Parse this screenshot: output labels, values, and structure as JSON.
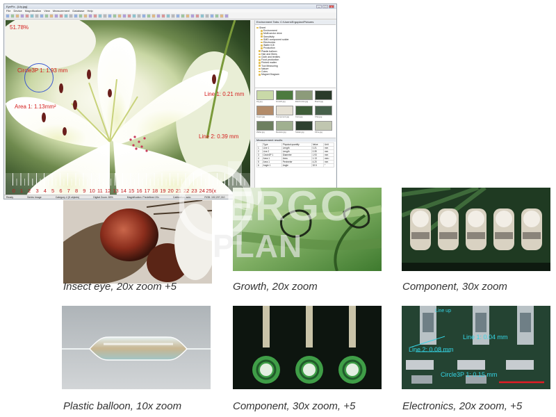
{
  "app": {
    "title": "EyePix - [Lily.jpg]",
    "menu": [
      "File",
      "Device",
      "Magnification",
      "View",
      "Measurement",
      "Database",
      "Help"
    ],
    "measurements": {
      "top_left": "51.78%",
      "circle": "Circle3P 1: 1.93 mm",
      "line1": "Line 1: 0.21 mm",
      "area": "Area 1: 1.13mm²",
      "line2": "Line 2: 0.39 mm"
    },
    "ruler": [
      "0",
      "1",
      "2",
      "3",
      "4",
      "5",
      "6",
      "7",
      "8",
      "9",
      "10",
      "11",
      "12",
      "13",
      "14",
      "15",
      "16",
      "17",
      "18",
      "19",
      "20",
      "21",
      "22",
      "23",
      "24",
      "25(x"
    ],
    "tree_header": "Environment Tabs: C:\\Users\\Ergoplan\\Pictures",
    "tree": [
      "Sheet",
      "Environment",
      "Multi-sector drive",
      "Sensitivity",
      "SMD component solder",
      "Electronics",
      "Wafer IC8",
      "Production",
      "Plastic balloon",
      "Hair and fibers",
      "Cloth and textiles",
      "Food production",
      "Printed matter",
      "Tool Measuring",
      "Nature",
      "Coins",
      "Magnet Diagram"
    ],
    "thumb_captions": [
      "Lily.jpg",
      "Growth.jpg",
      "Electronics.jpg",
      "Board.jpg",
      "Insect.jpg",
      "Component.jpg",
      "Coin.jpg",
      "Chip.jpg",
      "Wafer.jpg",
      "Resistor.jpg",
      "Solder.jpg",
      "Fibre.jpg"
    ],
    "meas_table_header": "Measurement results",
    "meas_cols": [
      "",
      "Type",
      "Physical quantity",
      "Value",
      "Unit"
    ],
    "meas_rows": [
      [
        "1",
        "Line 1",
        "Length",
        "0.21",
        "mm"
      ],
      [
        "2",
        "Line 2",
        "Length",
        "0.39",
        "mm"
      ],
      [
        "3",
        "Circle3P 1",
        "Diameter",
        "1.93",
        "mm"
      ],
      [
        "4",
        "Area 1",
        "Area",
        "1.13",
        "mm²"
      ],
      [
        "5",
        "Area 1",
        "Perimeter",
        "4.20",
        "mm"
      ],
      [
        "6",
        "Angle 1",
        "Angle",
        "32.5",
        "°"
      ]
    ],
    "status": [
      "Ready",
      "Series Image",
      "Category 4 (5 objects)",
      "Digital Zoom: 80%",
      "Magnification: Predefined 20x",
      "Calibration: auto",
      "RGB: 192,207,210"
    ]
  },
  "watermark": {
    "line1": "ERGO",
    "line2": "PLAN"
  },
  "gallery": [
    {
      "caption": "Insect eye, 20x zoom +5"
    },
    {
      "caption": "Growth, 20x zoom"
    },
    {
      "caption": "Component, 30x zoom"
    },
    {
      "caption": "Plastic balloon, 10x zoom"
    },
    {
      "caption": "Component, 30x zoom, +5"
    },
    {
      "caption": "Electronics, 20x zoom, +5"
    }
  ],
  "electronics_labels": {
    "line1": "Line 1: 0.04 mm",
    "line2": "Line 2: 0.08 mm",
    "circle": "Circle3P 1: 0.15 mm",
    "top": "Line up"
  },
  "colors": {
    "measure_red": "#d41c1c",
    "measure_cyan": "#35d7e8",
    "caption": "#333333"
  }
}
